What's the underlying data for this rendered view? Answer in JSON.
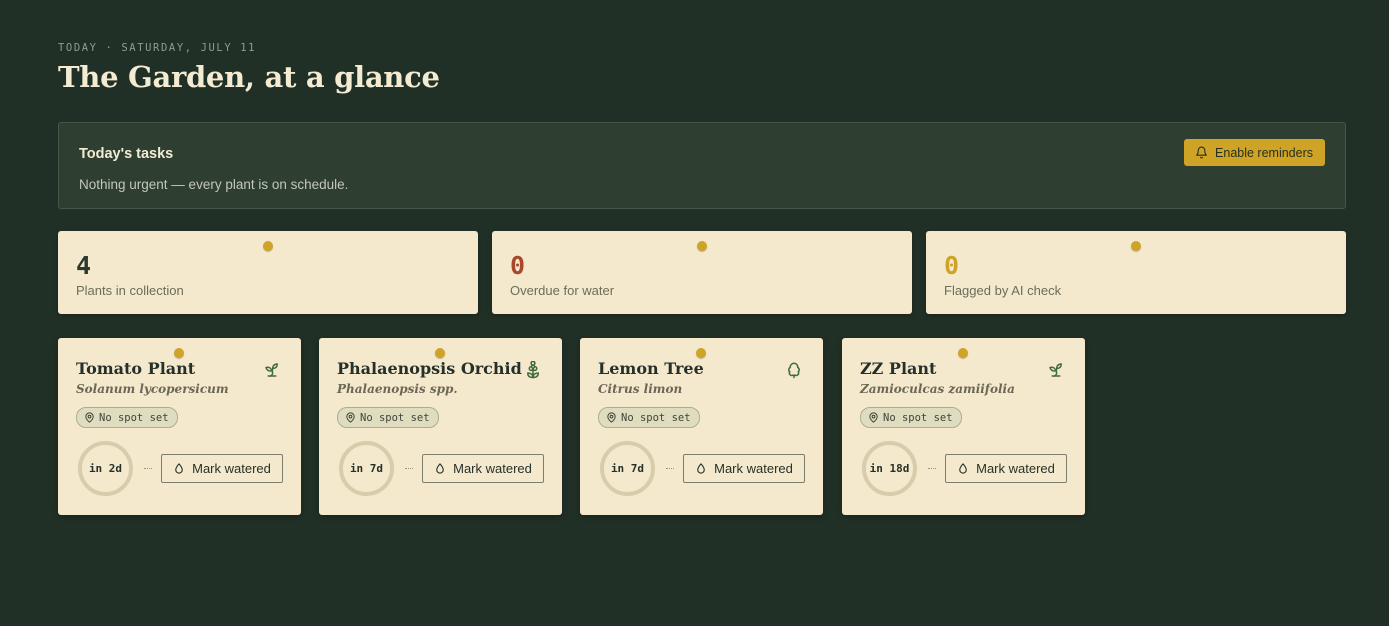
{
  "header": {
    "eyebrow": "TODAY · SATURDAY, JULY 11",
    "title": "The Garden, at a glance"
  },
  "tasks": {
    "title": "Today's tasks",
    "message": "Nothing urgent — every plant is on schedule.",
    "reminder_button": "Enable reminders",
    "reminder_icon": "bell-icon"
  },
  "stats": [
    {
      "value": "4",
      "label": "Plants in collection",
      "color": "#2b3a2e"
    },
    {
      "value": "0",
      "label": "Overdue for water",
      "color": "#a9492c"
    },
    {
      "value": "0",
      "label": "Flagged by AI check",
      "color": "#cfa326"
    }
  ],
  "plants": [
    {
      "name": "Tomato Plant",
      "scientific": "Solanum lycopersicum",
      "icon": "sprout-icon",
      "spot": "No spot set",
      "next_water": "in 2d",
      "action": "Mark watered"
    },
    {
      "name": "Phalaenopsis Orchid",
      "scientific": "Phalaenopsis spp.",
      "icon": "flower-icon",
      "spot": "No spot set",
      "next_water": "in 7d",
      "action": "Mark watered"
    },
    {
      "name": "Lemon Tree",
      "scientific": "Citrus limon",
      "icon": "tree-icon",
      "spot": "No spot set",
      "next_water": "in 7d",
      "action": "Mark watered"
    },
    {
      "name": "ZZ Plant",
      "scientific": "Zamioculcas zamiifolia",
      "icon": "sprout-icon",
      "spot": "No spot set",
      "next_water": "in 18d",
      "action": "Mark watered"
    }
  ],
  "colors": {
    "background": "#213026",
    "panel": "#2e3e31",
    "card": "#f5e9cd",
    "accent": "#cfa326",
    "ink": "#25302a"
  }
}
